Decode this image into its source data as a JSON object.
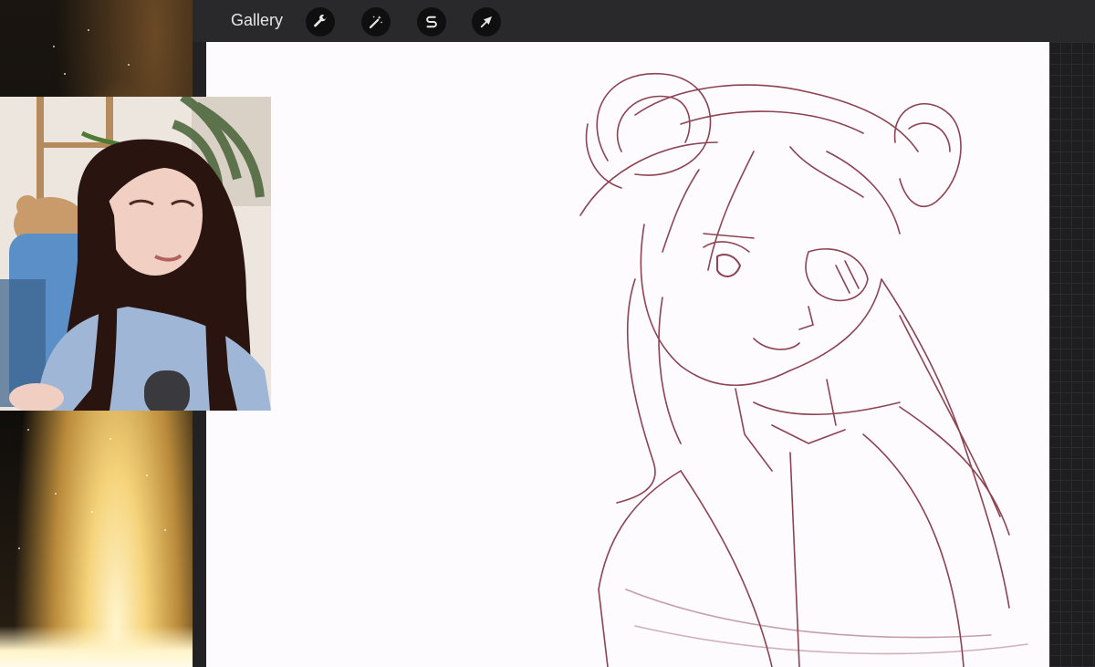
{
  "toolbar": {
    "gallery_label": "Gallery",
    "tools": [
      {
        "name": "actions",
        "icon": "wrench-icon"
      },
      {
        "name": "adjustments",
        "icon": "magic-wand-icon"
      },
      {
        "name": "selection",
        "icon": "selection-s-icon"
      },
      {
        "name": "transform",
        "icon": "arrow-cursor-icon"
      }
    ]
  },
  "sidebar": {
    "undo_icon": "undo-arrow-icon",
    "undo_symbol": "⤺"
  },
  "colors": {
    "chrome": "#29282b",
    "sketch_line": "#7a2434",
    "canvas": "#fdfbfd"
  }
}
